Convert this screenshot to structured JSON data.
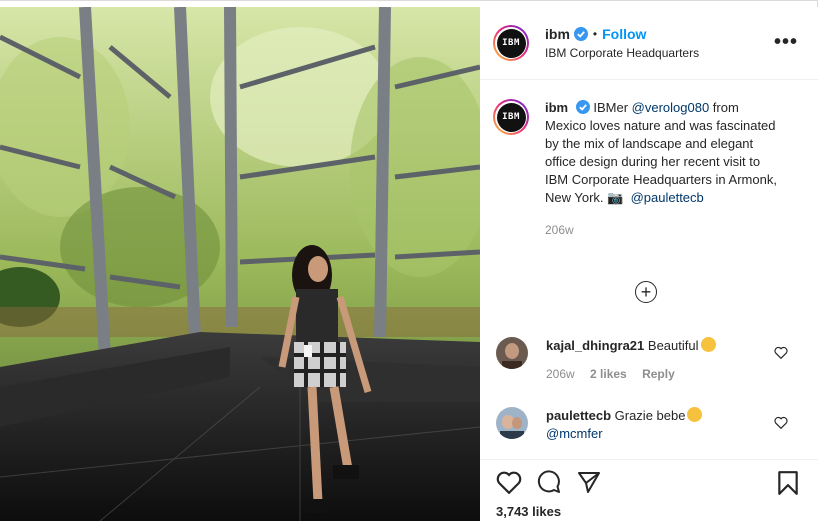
{
  "post": {
    "username": "ibm",
    "follow_label": "Follow",
    "location": "IBM Corporate Headquarters",
    "more_label": "•••",
    "dot": "•",
    "avatar_logo": "IBM"
  },
  "caption": {
    "username": "ibm",
    "text_before": " IBMer ",
    "mention1": "@verolog080",
    "text_after": " from Mexico loves nature and was fascinated by the mix of landscape and elegant office design during her recent visit to IBM Corporate Headquarters in Armonk, New York. ",
    "camera": "📷",
    "mention2": "@paulettecb",
    "age": "206w"
  },
  "load_more": "+",
  "comments": [
    {
      "username": "kajal_dhingra21",
      "text": "Beautiful",
      "emoji": "smiling-face-icon",
      "age": "206w",
      "likes": "2 likes",
      "reply": "Reply"
    },
    {
      "username": "paulettecb",
      "text": "Grazie bebe",
      "emoji": "kissing-face-icon",
      "mention": "@mcmfer"
    }
  ],
  "likes_count": "3,743 likes",
  "colors": {
    "accent": "#0095f6",
    "mention": "#00376b",
    "muted": "#8e8e8e",
    "text": "#262626"
  }
}
